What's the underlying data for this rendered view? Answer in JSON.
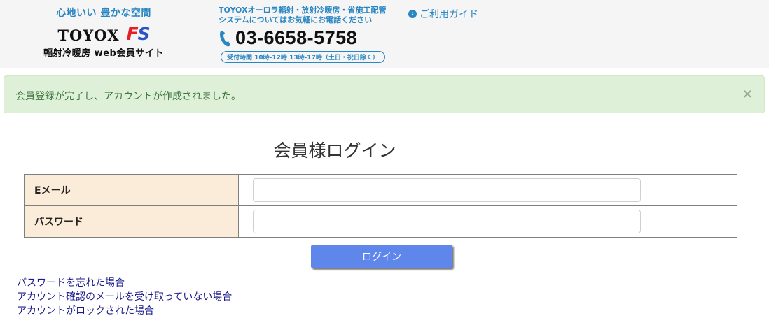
{
  "header": {
    "tagline": "心地いい 豊かな空間",
    "logo_text": "TOYOX",
    "logo_fs_f": "F",
    "logo_fs_s": "S",
    "subtitle": "輻射冷暖房 web会員サイト",
    "contact_line1": "TOYOXオーロラ輻射・放射冷暖房・省施工配管",
    "contact_line2": "システムについてはお気軽にお電話ください",
    "phone": "03-6658-5758",
    "hours": "受付時間 10時-12時 13時-17時（土日・祝日除く）",
    "guide_link": "ご利用ガイド",
    "guide_icon_glyph": "›"
  },
  "alert": {
    "message": "会員登録が完了し、アカウントが作成されました。",
    "close_glyph": "×"
  },
  "login": {
    "title": "会員様ログイン",
    "email_label": "Eメール",
    "email_value": "",
    "password_label": "パスワード",
    "password_value": "",
    "submit_label": "ログイン"
  },
  "links": [
    "パスワードを忘れた場合",
    "アカウント確認のメールを受け取っていない場合",
    "アカウントがロックされた場合"
  ],
  "colors": {
    "brand_blue": "#2a86c2",
    "alert_bg": "#dff0d8",
    "alert_text": "#3c763d",
    "label_bg": "#fbebd9",
    "button_bg": "#5f86ea",
    "logo_red": "#e41f25",
    "logo_blue": "#2954c4"
  },
  "icons": {
    "phone": "phone-icon",
    "guide": "chevron-circle-right-icon",
    "close": "close-icon"
  }
}
